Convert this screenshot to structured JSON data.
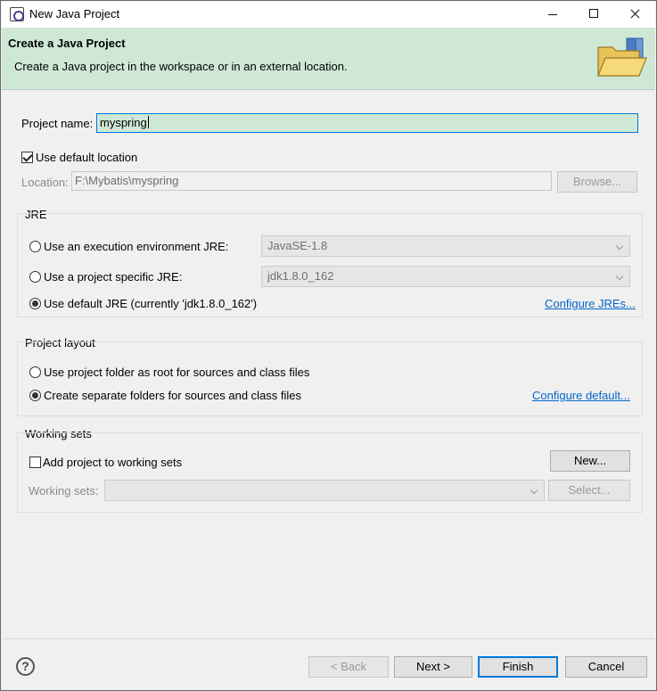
{
  "window": {
    "title": "New Java Project"
  },
  "banner": {
    "title": "Create a Java Project",
    "description": "Create a Java project in the workspace or in an external location."
  },
  "project": {
    "name_label": "Project name:",
    "name_value": "myspring",
    "use_default_location_label": "Use default location",
    "use_default_location_checked": true,
    "location_label": "Location:",
    "location_value": "F:\\Mybatis\\myspring",
    "browse_label": "Browse..."
  },
  "jre": {
    "group_title": "JRE",
    "exec_env_label": "Use an execution environment JRE:",
    "exec_env_value": "JavaSE-1.8",
    "specific_label": "Use a project specific JRE:",
    "specific_value": "jdk1.8.0_162",
    "default_label": "Use default JRE (currently 'jdk1.8.0_162')",
    "selected": "default",
    "configure_link": "Configure JREs..."
  },
  "layout": {
    "group_title": "Project layout",
    "root_label": "Use project folder as root for sources and class files",
    "separate_label": "Create separate folders for sources and class files",
    "selected": "separate",
    "configure_link": "Configure default..."
  },
  "working_sets": {
    "group_title": "Working sets",
    "add_label": "Add project to working sets",
    "add_checked": false,
    "new_button": "New...",
    "sets_label": "Working sets:",
    "sets_value": "",
    "select_button": "Select..."
  },
  "footer": {
    "help_icon": "?",
    "back_button": "< Back",
    "next_button": "Next >",
    "finish_button": "Finish",
    "cancel_button": "Cancel"
  },
  "colors": {
    "banner_bg": "#cfe8d6",
    "link": "#0066cc",
    "focus_border": "#0078d7"
  }
}
